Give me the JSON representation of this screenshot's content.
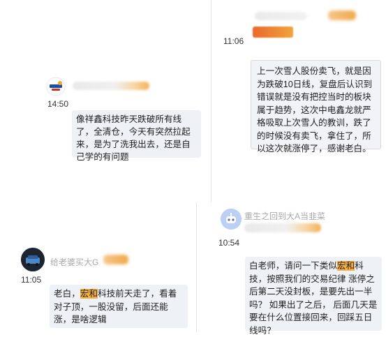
{
  "messages": [
    {
      "time": "11:06",
      "side": "right",
      "text": "上一次雪人股份卖飞，就是因为跌破10日线，复盘后认识到错误就是没有把控当时的板块属于趋势，这次中电鑫龙就严格吸取上次雪人的教训，跌了的时候没有卖飞，拿住了，所以这次就涨停了，感谢老白。"
    },
    {
      "time": "14:50",
      "side": "left",
      "text": "像祥鑫科技昨天跌破所有线了，全清仓，今天有突然拉起来，是为了洗我出去，还是自己学的有问题"
    },
    {
      "time": "10:54",
      "side": "right",
      "username": "重生之回到大A当韭菜",
      "text_parts": [
        "白老师，请问一下类似",
        "宏和",
        "科技，按照我们的交易纪律 涨停之后第二天没封板，是要先出一半吗？ 如果出了之后， 后面几天是要在什么位置接回来，回踩五日线吗？"
      ]
    },
    {
      "time": "11:05",
      "side": "left",
      "username": "给老婆买大G",
      "text_parts": [
        "老白，",
        "宏和",
        "科技前天走了，看着对子顶，一股没留，后面还能涨，是啥逻辑"
      ]
    }
  ],
  "colors": {
    "bubble_bg": "#eef2f6",
    "highlight": "#f7b244",
    "divider": "#e3e3e3"
  }
}
